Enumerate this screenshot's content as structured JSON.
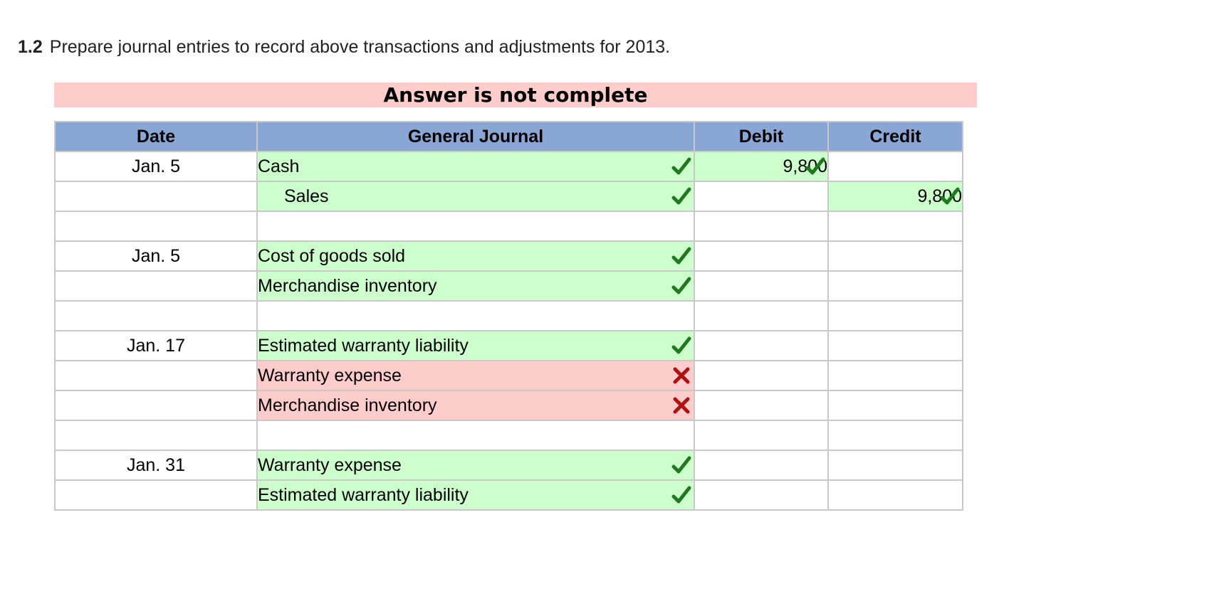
{
  "question": {
    "number": "1.2",
    "text": "Prepare journal entries to record above transactions and adjustments for 2013."
  },
  "banner": {
    "text": "Answer is not complete",
    "color": "#ffcccc"
  },
  "table": {
    "headers": {
      "date": "Date",
      "journal": "General Journal",
      "debit": "Debit",
      "credit": "Credit"
    },
    "header_color": "#8aa6d4",
    "correct_color": "#ccffcc",
    "wrong_color": "#ffcccc",
    "rows": [
      {
        "date": "Jan. 5",
        "account": "Cash",
        "indent": false,
        "status": "correct",
        "debit": "9,800",
        "debit_status": "correct",
        "credit": "",
        "credit_status": ""
      },
      {
        "date": "",
        "account": "Sales",
        "indent": true,
        "status": "correct",
        "debit": "",
        "debit_status": "",
        "credit": "9,800",
        "credit_status": "correct"
      },
      {
        "date": "",
        "account": "",
        "indent": false,
        "status": "",
        "debit": "",
        "debit_status": "",
        "credit": "",
        "credit_status": ""
      },
      {
        "date": "Jan. 5",
        "account": "Cost of goods sold",
        "indent": false,
        "status": "correct",
        "debit": "",
        "debit_status": "",
        "credit": "",
        "credit_status": ""
      },
      {
        "date": "",
        "account": "Merchandise inventory",
        "indent": false,
        "status": "correct",
        "debit": "",
        "debit_status": "",
        "credit": "",
        "credit_status": ""
      },
      {
        "date": "",
        "account": "",
        "indent": false,
        "status": "",
        "debit": "",
        "debit_status": "",
        "credit": "",
        "credit_status": ""
      },
      {
        "date": "Jan. 17",
        "account": "Estimated warranty liability",
        "indent": false,
        "status": "correct",
        "debit": "",
        "debit_status": "",
        "credit": "",
        "credit_status": ""
      },
      {
        "date": "",
        "account": "Warranty expense",
        "indent": false,
        "status": "wrong",
        "debit": "",
        "debit_status": "",
        "credit": "",
        "credit_status": ""
      },
      {
        "date": "",
        "account": "Merchandise inventory",
        "indent": false,
        "status": "wrong",
        "debit": "",
        "debit_status": "",
        "credit": "",
        "credit_status": ""
      },
      {
        "date": "",
        "account": "",
        "indent": false,
        "status": "",
        "debit": "",
        "debit_status": "",
        "credit": "",
        "credit_status": ""
      },
      {
        "date": "Jan. 31",
        "account": "Warranty expense",
        "indent": false,
        "status": "correct",
        "debit": "",
        "debit_status": "",
        "credit": "",
        "credit_status": ""
      },
      {
        "date": "",
        "account": "Estimated warranty liability",
        "indent": false,
        "status": "correct",
        "debit": "",
        "debit_status": "",
        "credit": "",
        "credit_status": ""
      }
    ]
  },
  "icons": {
    "correct": "checkmark-icon",
    "wrong": "x-mark-icon"
  }
}
